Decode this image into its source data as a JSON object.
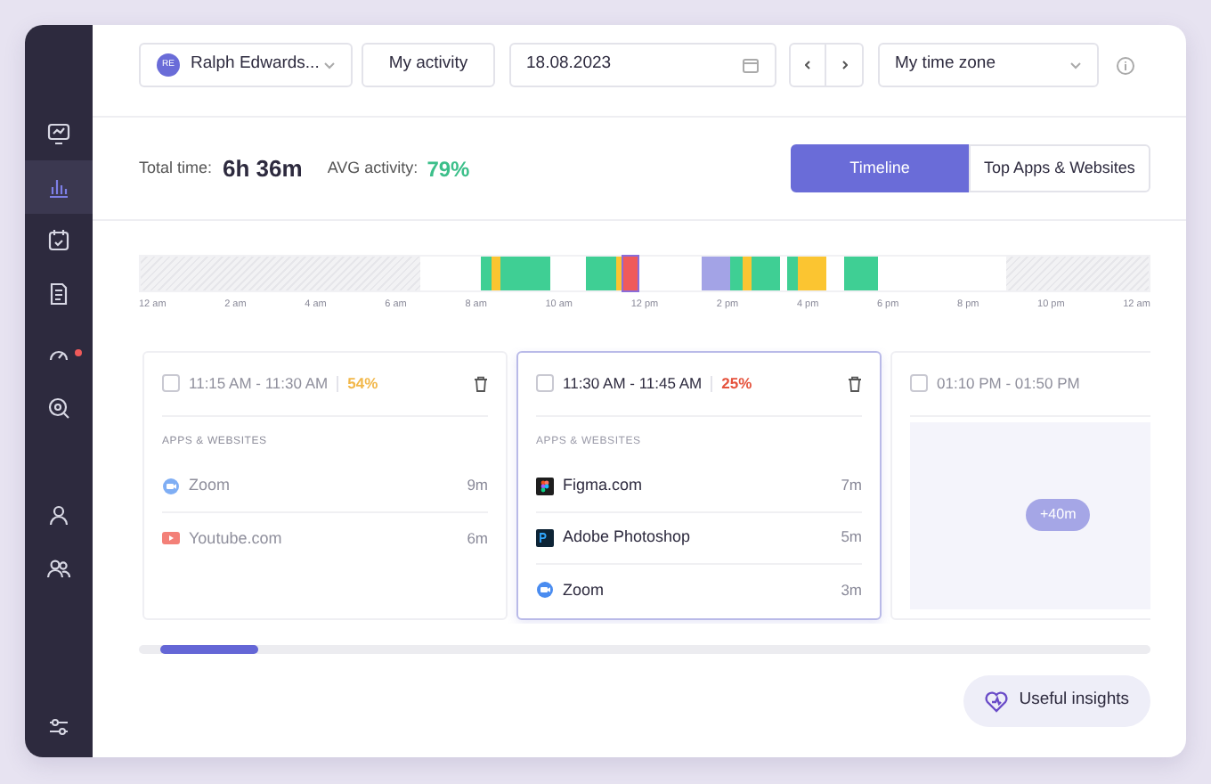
{
  "sidebar": {
    "items": [
      {
        "kind": "monitor",
        "selected": false,
        "alert": false
      },
      {
        "kind": "bars",
        "selected": true,
        "alert": false
      },
      {
        "kind": "calendar",
        "selected": false,
        "alert": false
      },
      {
        "kind": "document",
        "selected": false,
        "alert": false
      },
      {
        "kind": "gauge",
        "selected": false,
        "alert": true
      },
      {
        "kind": "gear",
        "selected": false,
        "alert": false
      },
      {
        "kind": "user",
        "selected": false,
        "alert": false
      },
      {
        "kind": "users",
        "selected": false,
        "alert": false
      }
    ],
    "bottom": {
      "kind": "sliders"
    }
  },
  "toolbar": {
    "user": {
      "initials": "RE",
      "name": "Ralph Edwards..."
    },
    "activity_button": "My activity",
    "date": "18.08.2023",
    "timezone": "My time zone"
  },
  "summary": {
    "total_label": "Total time:",
    "total": "6h 36m",
    "avg_label": "AVG activity:",
    "avg": "79%"
  },
  "tabs": [
    {
      "label": "Timeline",
      "selected": true
    },
    {
      "label": "Top Apps & Websites",
      "selected": false
    }
  ],
  "timeline_ticks": [
    "12 am",
    "2 am",
    "4 am",
    "6 am",
    "8 am",
    "10 am",
    "12 pm",
    "2 pm",
    "4 pm",
    "6 pm",
    "8 pm",
    "10 pm",
    "12 am"
  ],
  "cards": [
    {
      "time": "11:15 AM - 11:30 AM",
      "activity": "54%",
      "color": "#f2b84b",
      "selected": false,
      "checked": false,
      "section": "APPS & WEBSITES",
      "apps": [
        {
          "kind": "zoom",
          "name": "Zoom",
          "duration": "9m"
        },
        {
          "kind": "youtube",
          "name": "Youtube.com",
          "duration": "6m"
        }
      ]
    },
    {
      "time": "11:30 AM - 11:45 AM",
      "activity": "25%",
      "color": "#e5533d",
      "selected": true,
      "checked": false,
      "section": "APPS & WEBSITES",
      "apps": [
        {
          "kind": "figma",
          "name": "Figma.com",
          "duration": "7m"
        },
        {
          "kind": "photoshop",
          "name": "Adobe Photoshop",
          "duration": "5m"
        },
        {
          "kind": "zoom",
          "name": "Zoom",
          "duration": "3m"
        }
      ]
    },
    {
      "time": "01:10 PM - 01:50 PM",
      "selected": false,
      "checked": false,
      "more": "+40m"
    }
  ],
  "insights_button": "Useful insights"
}
